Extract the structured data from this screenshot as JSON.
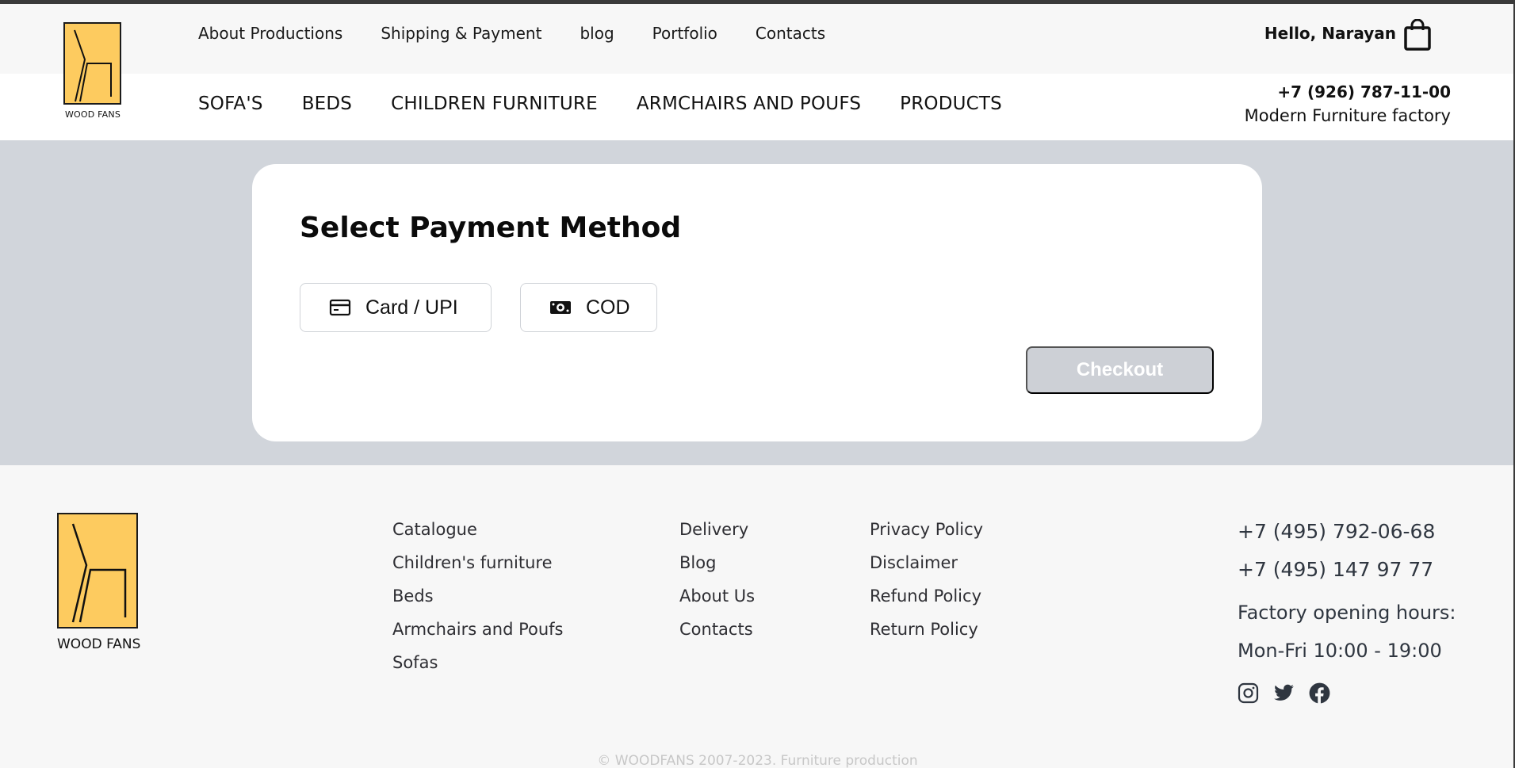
{
  "brand": {
    "name": "WOOD FANS",
    "accent": "#fdcb5f"
  },
  "header": {
    "top_nav": [
      "About Productions",
      "Shipping & Payment",
      "blog",
      "Portfolio",
      "Contacts"
    ],
    "greeting": "Hello, Narayan",
    "cart_icon": "shopping-bag-icon",
    "main_nav": [
      "SOFA'S",
      "BEDS",
      "CHILDREN FURNITURE",
      "ARMCHAIRS AND POUFS",
      "PRODUCTS"
    ],
    "phone": "+7 (926) 787-11-00",
    "tagline": "Modern Furniture factory"
  },
  "payment": {
    "title": "Select Payment Method",
    "options": [
      {
        "label": "Card / UPI",
        "icon": "credit-card-icon"
      },
      {
        "label": "COD",
        "icon": "cash-icon"
      }
    ],
    "checkout_label": "Checkout",
    "checkout_color": "#cdd0d6"
  },
  "footer": {
    "col1": [
      "Catalogue",
      "Children's furniture",
      "Beds",
      "Armchairs and Poufs",
      "Sofas"
    ],
    "col2": [
      "Delivery",
      "Blog",
      "About Us",
      "Contacts"
    ],
    "col3": [
      "Privacy Policy",
      "Disclaimer",
      "Refund Policy",
      "Return Policy"
    ],
    "phone1": "+7 (495) 792-06-68",
    "phone2": "+7 (495) 147 97 77",
    "hours_label": "Factory opening hours:",
    "hours": "Mon-Fri 10:00 - 19:00",
    "social": [
      "instagram-icon",
      "twitter-icon",
      "facebook-icon"
    ],
    "copyright": "© WOODFANS 2007-2023. Furniture production"
  }
}
